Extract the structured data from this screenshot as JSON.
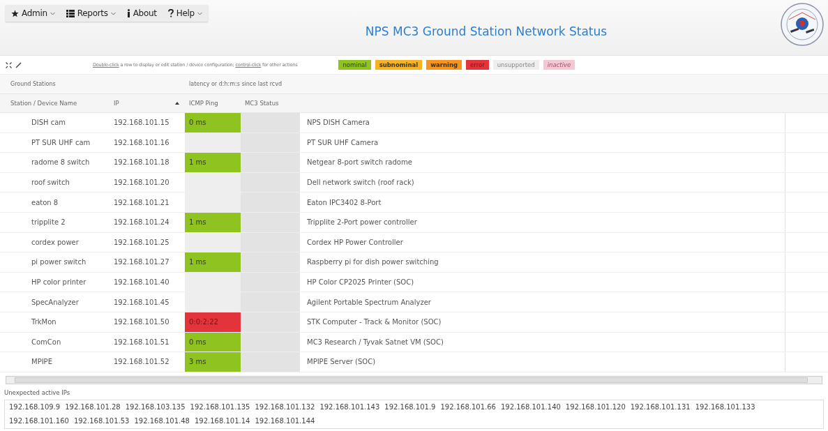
{
  "menu": [
    {
      "kind": "star",
      "label": "Admin",
      "dropdown": true
    },
    {
      "kind": "list",
      "label": "Reports",
      "dropdown": true
    },
    {
      "kind": "info",
      "label": "About",
      "dropdown": false
    },
    {
      "kind": "question",
      "label": "Help",
      "dropdown": true
    }
  ],
  "title": "NPS MC3 Ground Station Network Status",
  "hint": {
    "link1": "Double-click",
    "middle": "a row to display or edit station / device configuration;",
    "link2": "control-click",
    "end": "for other actions"
  },
  "legend": [
    {
      "label": "nominal",
      "kind": "nominal"
    },
    {
      "label": "subnominal",
      "kind": "subnominal"
    },
    {
      "label": "warning",
      "kind": "warning"
    },
    {
      "label": "error",
      "kind": "error"
    },
    {
      "label": "unsupported",
      "kind": "unsupported"
    },
    {
      "label": "inactive",
      "kind": "inactive"
    }
  ],
  "table": {
    "group_headers": [
      "Ground Stations",
      "latency or d:h:m:s since last rcvd"
    ],
    "columns": [
      "Station / Device Name",
      "IP",
      "ICMP Ping",
      "MC3 Status"
    ],
    "rows": [
      {
        "name": "DISH cam",
        "ip": "192.168.101.15",
        "ping": "0 ms",
        "kind": "nominal",
        "description": "NPS DISH Camera"
      },
      {
        "name": "PT SUR UHF cam",
        "ip": "192.168.101.16",
        "kind": "unsupported",
        "description": "PT SUR UHF Camera"
      },
      {
        "name": "radome 8 switch",
        "ip": "192.168.101.18",
        "ping": "1 ms",
        "kind": "nominal",
        "description": "Netgear 8-port switch radome"
      },
      {
        "name": "roof switch",
        "ip": "192.168.101.20",
        "kind": "unsupported",
        "description": "Dell network switch (roof rack)"
      },
      {
        "name": "eaton 8",
        "ip": "192.168.101.21",
        "kind": "unsupported",
        "description": "Eaton IPC3402 8-Port"
      },
      {
        "name": "tripplite 2",
        "ip": "192.168.101.24",
        "ping": "1 ms",
        "kind": "nominal",
        "description": "Tripplite 2-Port power controller"
      },
      {
        "name": "cordex power",
        "ip": "192.168.101.25",
        "kind": "unsupported",
        "description": "Cordex HP Power Controller"
      },
      {
        "name": "pi power switch",
        "ip": "192.168.101.27",
        "ping": "1 ms",
        "kind": "nominal",
        "description": "Raspberry pi for dish power switching"
      },
      {
        "name": "HP color printer",
        "ip": "192.168.101.40",
        "kind": "unsupported",
        "description": "HP Color CP2025 Printer (SOC)"
      },
      {
        "name": "SpecAnalyzer",
        "ip": "192.168.101.45",
        "kind": "unsupported",
        "description": "Agilent Portable Spectrum Analyzer"
      },
      {
        "name": "TrkMon",
        "ip": "192.168.101.50",
        "ping": "0:0:2:22",
        "kind": "error",
        "description": "STK Computer - Track & Monitor (SOC)"
      },
      {
        "name": "ComCon",
        "ip": "192.168.101.51",
        "ping": "0 ms",
        "kind": "nominal",
        "description": "MC3 Research / Tyvak Satnet VM (SOC)"
      },
      {
        "name": "MPIPE",
        "ip": "192.168.101.52",
        "ping": "3 ms",
        "kind": "nominal",
        "description": "MPIPE Server (SOC)"
      }
    ]
  },
  "unexpected": {
    "label": "Unexpected active IPs",
    "ips": [
      "192.168.109.9",
      "192.168.101.28",
      "192.168.103.135",
      "192.168.101.135",
      "192.168.101.132",
      "192.168.101.143",
      "192.168.101.9",
      "192.168.101.66",
      "192.168.101.140",
      "192.168.101.120",
      "192.168.101.131",
      "192.168.101.133",
      "192.168.101.160",
      "192.168.101.53",
      "192.168.101.48",
      "192.168.101.14",
      "192.168.101.144"
    ]
  }
}
